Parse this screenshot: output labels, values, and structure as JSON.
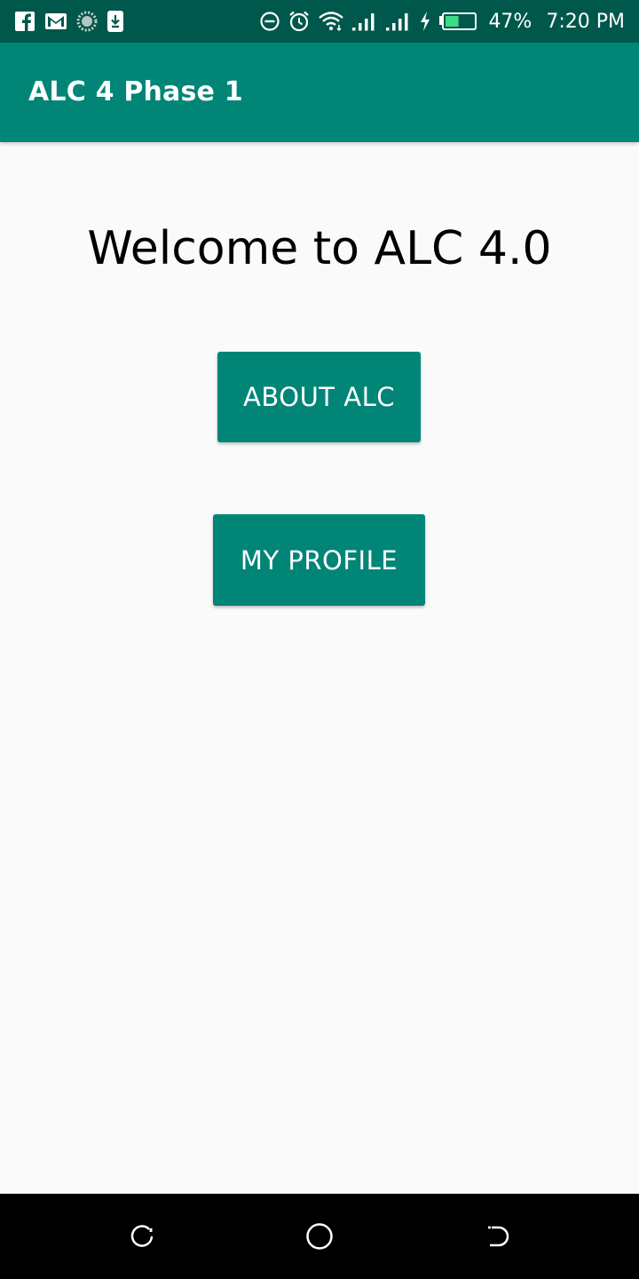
{
  "status_bar": {
    "left_icons": [
      "facebook-icon",
      "gmail-icon",
      "loading-circle-icon",
      "download-icon"
    ],
    "right_icons": [
      "do-not-disturb-icon",
      "alarm-icon",
      "wifi-icon",
      "signal-icon",
      "signal-icon",
      "charging-icon",
      "battery-icon"
    ],
    "battery_level": 47,
    "battery_text": "47%",
    "time": "7:20 PM"
  },
  "app_bar": {
    "title": "ALC 4 Phase 1",
    "color": "#008577"
  },
  "main": {
    "welcome_text": "Welcome to ALC 4.0",
    "about_button_label": "ABOUT ALC",
    "profile_button_label": "MY PROFILE",
    "button_color": "#008577"
  },
  "nav_bar": {
    "buttons": [
      "recent-apps-icon",
      "home-icon",
      "back-icon"
    ]
  },
  "colors": {
    "status_bar": "#00574b",
    "accent": "#008577",
    "background": "#fafafa"
  }
}
